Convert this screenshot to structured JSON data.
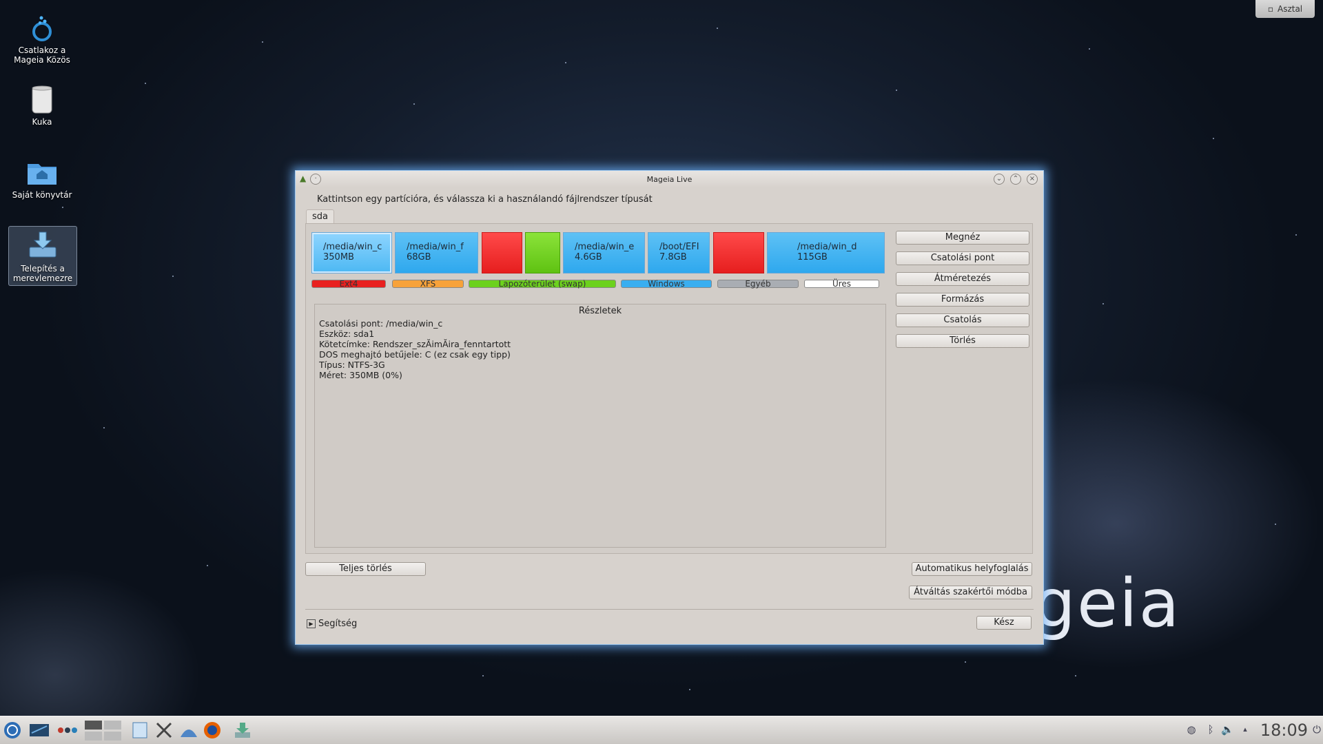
{
  "desktop": {
    "icons": [
      {
        "label": "Csatlakoz a Mageia Közös"
      },
      {
        "label": "Kuka"
      },
      {
        "label": "Saját könyvtár"
      },
      {
        "label": "Telepítés a merevlemezre"
      }
    ],
    "show_desktop_button": "Asztal",
    "brand_text": "geia"
  },
  "window": {
    "title": "Mageia Live",
    "instruction": "Kattintson egy partícióra, és válassza ki a használandó fájlrendszer típusát",
    "disk_tab": "sda",
    "partitions": [
      {
        "label": "/media/win_c",
        "size": "350MB",
        "type": "Windows",
        "selected": true
      },
      {
        "label": "/media/win_f",
        "size": "68GB",
        "type": "Windows"
      },
      {
        "label": "",
        "size": "",
        "type": "Ext4"
      },
      {
        "label": "",
        "size": "",
        "type": "Lapozóterület (swap)"
      },
      {
        "label": "/media/win_e",
        "size": "4.6GB",
        "type": "Windows"
      },
      {
        "label": "/boot/EFI",
        "size": "7.8GB",
        "type": "Windows"
      },
      {
        "label": "",
        "size": "",
        "type": "Ext4"
      },
      {
        "label": "/media/win_d",
        "size": "115GB",
        "type": "Windows"
      }
    ],
    "legend": [
      {
        "label": "Ext4",
        "color": "#e8201f"
      },
      {
        "label": "XFS",
        "color": "#f7a23a"
      },
      {
        "label": "Lapozóterület (swap)",
        "color": "#6cd11d"
      },
      {
        "label": "Windows",
        "color": "#39aef0"
      },
      {
        "label": "Egyéb",
        "color": "#a9adb3"
      },
      {
        "label": "Üres",
        "color": "#ffffff"
      }
    ],
    "details": {
      "title": "Részletek",
      "lines": [
        "Csatolási pont: /media/win_c",
        "Eszköz: sda1",
        "Kötetcímke: Rendszer_szĂimĂira_fenntartott",
        "DOS meghajtó betűjele: C (ez csak egy tipp)",
        "Típus: NTFS-3G",
        "Méret: 350MB (0%)"
      ]
    },
    "actions": [
      "Megnéz",
      "Csatolási pont",
      "Átméretezés",
      "Formázás",
      "Csatolás",
      "Törlés"
    ],
    "clear_all": "Teljes törlés",
    "auto_allocate": "Automatikus helyfoglalás",
    "expert_mode": "Átváltás szakértői módba",
    "help": "Segítség",
    "done": "Kész"
  },
  "taskbar": {
    "clock": "18:09"
  }
}
